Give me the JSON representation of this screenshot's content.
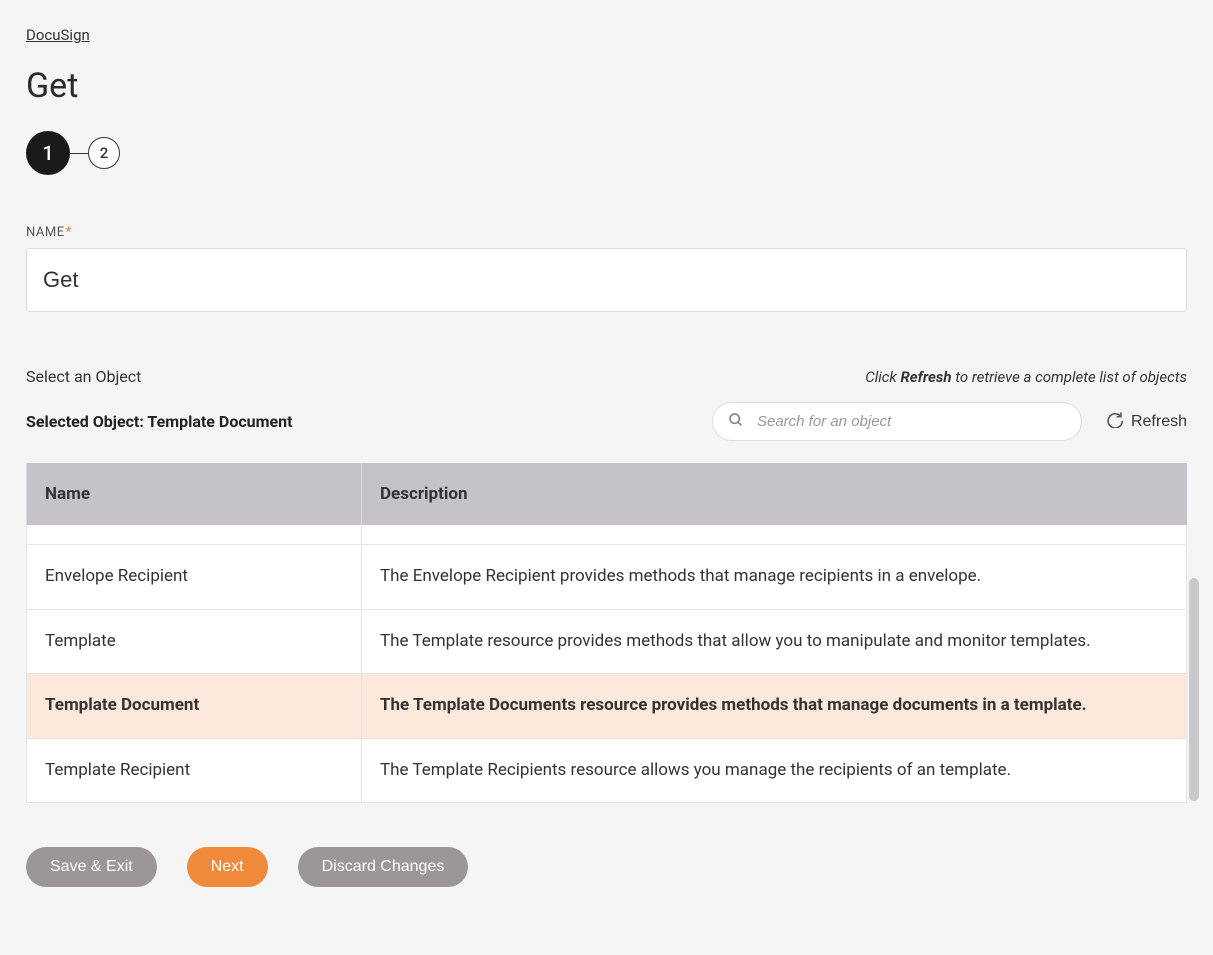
{
  "breadcrumb": {
    "label": "DocuSign"
  },
  "page_title": "Get",
  "stepper": {
    "steps": [
      "1",
      "2"
    ],
    "active_index": 0
  },
  "name_field": {
    "label": "NAME",
    "value": "Get"
  },
  "object_section": {
    "select_label": "Select an Object",
    "hint_prefix": "Click ",
    "hint_bold": "Refresh",
    "hint_suffix": " to retrieve a complete list of objects",
    "selected_label": "Selected Object: Template Document",
    "search_placeholder": "Search for an object",
    "refresh_label": "Refresh"
  },
  "table": {
    "headers": {
      "name": "Name",
      "description": "Description"
    },
    "rows": [
      {
        "name": "Envelope Recipient",
        "description": "The Envelope Recipient provides methods that manage recipients in a envelope.",
        "selected": false
      },
      {
        "name": "Template",
        "description": "The Template resource provides methods that allow you to manipulate and monitor templates.",
        "selected": false
      },
      {
        "name": "Template Document",
        "description": "The Template Documents resource provides methods that manage documents in a template.",
        "selected": true
      },
      {
        "name": "Template Recipient",
        "description": "The Template Recipients resource allows you manage the recipients of an template.",
        "selected": false
      }
    ]
  },
  "footer": {
    "save_exit": "Save & Exit",
    "next": "Next",
    "discard": "Discard Changes"
  }
}
